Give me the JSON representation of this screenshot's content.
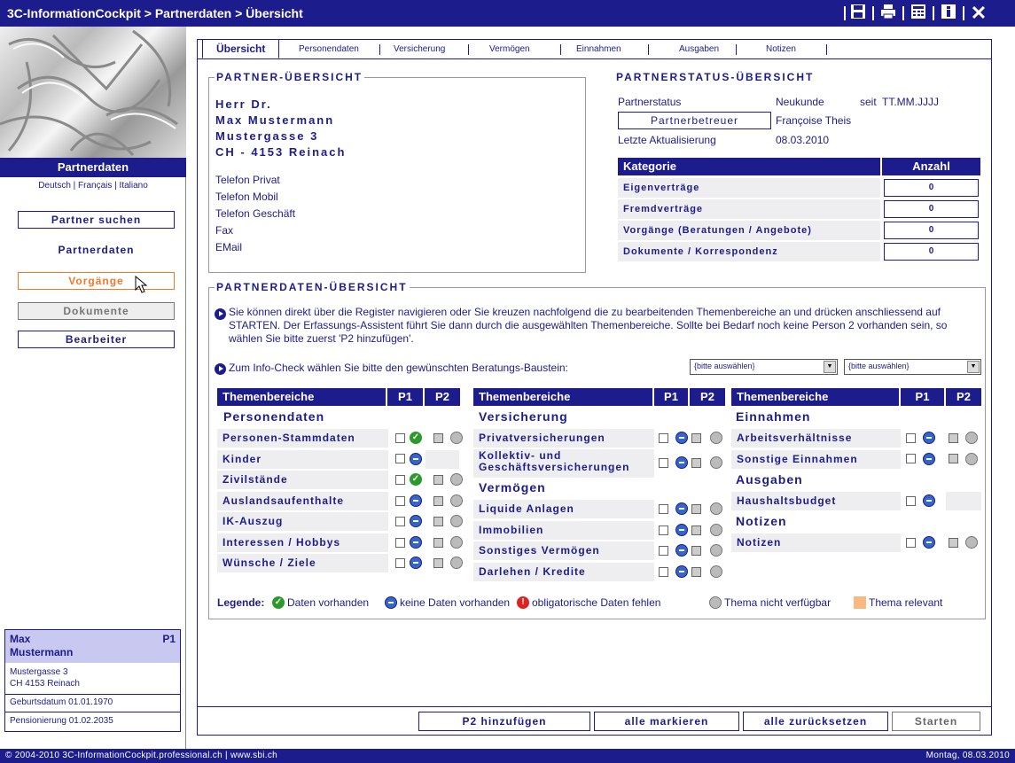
{
  "window": {
    "title": "3C-InformationCockpit > Partnerdaten > Übersicht"
  },
  "sidebar": {
    "heading": "Partnerdaten",
    "languages": "Deutsch  |  Français  |  Italiano",
    "items": [
      {
        "label": "Partner suchen"
      },
      {
        "label": "Partnerdaten"
      },
      {
        "label": "Vorgänge"
      },
      {
        "label": "Dokumente"
      },
      {
        "label": "Bearbeiter"
      }
    ],
    "card": {
      "first_name": "Max",
      "last_name": "Mustermann",
      "tag": "P1",
      "street": "Mustergasse 3",
      "city": "CH   4153  Reinach",
      "birth": "Geburtsdatum  01.01.1970",
      "retirement": "Pensionierung  01.02.2035"
    }
  },
  "tabs": [
    "Übersicht",
    "Personendaten",
    "Versicherung",
    "Vermögen",
    "Einnahmen",
    "Ausgaben",
    "Notizen"
  ],
  "partner": {
    "legend": "PARTNER-ÜBERSICHT",
    "salutation": "Herr Dr.",
    "name": "Max Mustermann",
    "street": "Mustergasse 3",
    "city": "CH - 4153 Reinach",
    "contacts": [
      "Telefon Privat",
      "Telefon Mobil",
      "Telefon Geschäft",
      "Fax",
      "EMail"
    ]
  },
  "status": {
    "legend": "PARTNERSTATUS-ÜBERSICHT",
    "status_label": "Partnerstatus",
    "status_value": "Neukunde",
    "since_label": "seit",
    "since_value": "TT.MM.JJJJ",
    "advisor_button": "Partnerbetreuer",
    "advisor_name": "Françoise Theis",
    "update_label": "Letzte Aktualisierung",
    "update_value": "08.03.2010",
    "col_category": "Kategorie",
    "col_count": "Anzahl",
    "rows": [
      {
        "label": "Eigenverträge",
        "count": "0"
      },
      {
        "label": "Fremdverträge",
        "count": "0"
      },
      {
        "label": "Vorgänge (Beratungen / Angebote)",
        "count": "0"
      },
      {
        "label": "Dokumente / Korrespondenz",
        "count": "0"
      }
    ]
  },
  "overview": {
    "legend": "PARTNERDATEN-ÜBERSICHT",
    "info1": "Sie können direkt über die Register navigieren oder Sie kreuzen nachfolgend die zu bearbeitenden Themenbereiche an und drücken anschliessend auf STARTEN. Der Erfassungs-Assistent führt Sie dann durch die ausgewählten Themenbereiche.  Sollte bei Bedarf noch keine Person 2 vorhanden sein, so wählen Sie bitte zuerst 'P2 hinzufügen'.",
    "info2": "Zum Info-Check wählen Sie bitte den gewünschten Beratungs-Baustein:",
    "select1": "{bitte auswählen}",
    "select2": "{bitte auswählen}",
    "col_topic": "Themenbereiche",
    "col_p1": "P1",
    "col_p2": "P2",
    "groups": {
      "personendaten": "Personendaten",
      "versicherung": "Versicherung",
      "vermoegen": "Vermögen",
      "einnahmen": "Einnahmen",
      "ausgaben": "Ausgaben",
      "notizen": "Notizen"
    },
    "rows": {
      "c1": [
        "Personen-Stammdaten",
        "Kinder",
        "Zivilstände",
        "Auslandsaufenthalte",
        "IK-Auszug",
        "Interessen / Hobbys",
        "Wünsche / Ziele"
      ],
      "c2a": [
        "Privatversicherungen",
        "Kollektiv- und Geschäftsversicherungen"
      ],
      "c2b": [
        "Liquide Anlagen",
        "Immobilien",
        "Sonstiges Vermögen",
        "Darlehen / Kredite"
      ],
      "c3a": [
        "Arbeitsverhältnisse",
        "Sonstige Einnahmen"
      ],
      "c3b": [
        "Haushaltsbudget"
      ],
      "c3c": [
        "Notizen"
      ]
    },
    "legend_label": "Legende:",
    "legend_items": [
      "Daten vorhanden",
      "keine Daten vorhanden",
      "obligatorische Daten fehlen",
      "Thema nicht verfügbar",
      "Thema relevant"
    ]
  },
  "buttons": {
    "add_p2": "P2 hinzufügen",
    "mark_all": "alle markieren",
    "reset_all": "alle zurücksetzen",
    "start": "Starten"
  },
  "footer": {
    "copyright": "© 2004-2010 3C-InformationCockpit.professional.ch | www.sbi.ch",
    "date": "Montag, 08.03.2010"
  },
  "colors": {
    "primary": "#1c1c8c",
    "accent": "#f07828",
    "panel": "#eeeef0",
    "check_ok": "#2a9a2a",
    "no_data": "#3366cc"
  }
}
